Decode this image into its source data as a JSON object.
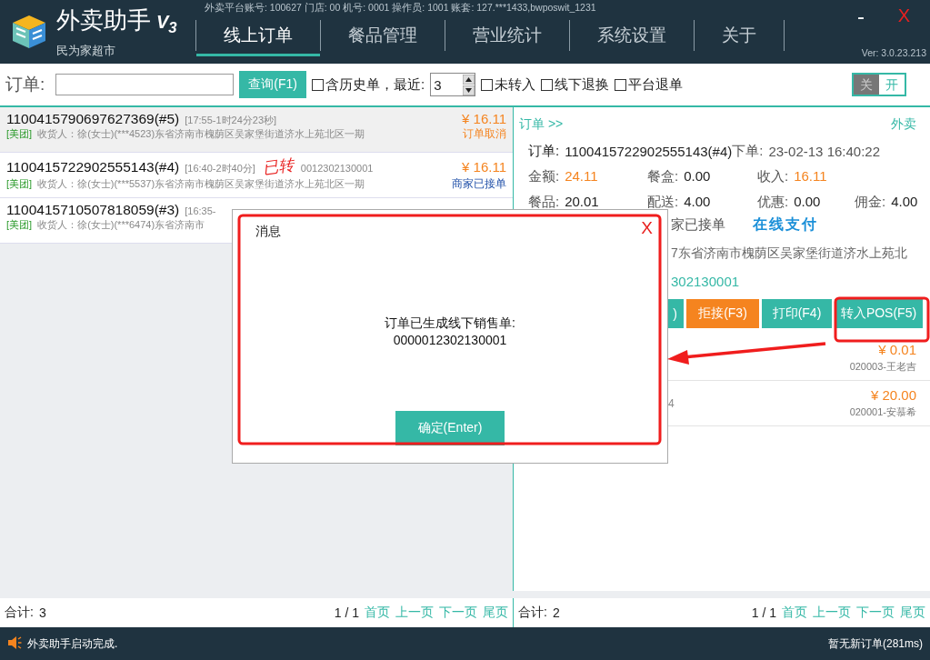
{
  "app": {
    "name": "外卖助手",
    "version_badge": "V$_{3}$",
    "subtitle": "民为家超市",
    "account_info": "外卖平台账号: 100627 门店: 00 机号: 0001 操作员: 1001 账套: 127.***1433,bwposwit_1231",
    "version": "Ver: 3.0.23.213",
    "minimize": "-",
    "close": "X"
  },
  "nav_tabs": [
    {
      "label": "线上订单",
      "selected": true
    },
    {
      "label": "餐品管理",
      "selected": false
    },
    {
      "label": "营业统计",
      "selected": false
    },
    {
      "label": "系统设置",
      "selected": false
    },
    {
      "label": "关于",
      "selected": false
    }
  ],
  "toolbar": {
    "order_label": "订单:",
    "search_button": "查询(F1)",
    "history": {
      "label": "含历史单，最近:",
      "checked": false
    },
    "recent_days": "3",
    "filters": [
      {
        "label": "未转入",
        "checked": false
      },
      {
        "label": "线下退换",
        "checked": false
      },
      {
        "label": "平台退单",
        "checked": false
      }
    ],
    "toggle": {
      "off_label": "关",
      "on_label": "开",
      "on": true
    }
  },
  "orders": [
    {
      "number": "1100415790697627369(#5)",
      "time": "[17:55-1时24分23秒]",
      "platform": "[美团]",
      "address": "收货人：徐(女士)(***4523)东省济南市槐荫区吴家堡街道济水上苑北区一期",
      "amount": "¥ 16.11",
      "status": "订单取消",
      "kind": "cancelled",
      "selected": true
    },
    {
      "number": "1100415722902555143(#4)",
      "time": "[16:40-2时40分]",
      "stamp": "已转",
      "pos_note": "0012302130001",
      "platform": "[美团]",
      "address": "收货人：徐(女士)(***5537)东省济南市槐荫区吴家堡街道济水上苑北区一期",
      "amount": "¥ 16.11",
      "status": "商家已接单",
      "kind": "accepted",
      "selected": false
    },
    {
      "number": "1100415710507818059(#3)",
      "time": "[16:35-",
      "platform": "[美团]",
      "address": "收货人：徐(女士)(***6474)东省济南市",
      "selected": false
    }
  ],
  "detail": {
    "breadcrumb": "订单 >>",
    "channel": "外卖",
    "order_label": "订单:",
    "order_number": "1100415722902555143(#4)",
    "placed_label": "下单:",
    "placed_time": "23-02-13 16:40:22",
    "field_rows": [
      [
        {
          "label": "金额:",
          "value": "24.11",
          "highlight": true
        },
        {
          "label": "餐盒:",
          "value": "0.00",
          "highlight": false
        },
        {
          "label": "收入:",
          "value": "16.11",
          "highlight": true
        }
      ],
      [
        {
          "label": "餐品:",
          "value": "20.01",
          "highlight": false
        },
        {
          "label": "配送:",
          "value": "4.00",
          "highlight": false
        },
        {
          "label": "优惠:",
          "value": "0.00",
          "highlight": false
        },
        {
          "label": "佣金:",
          "value": "4.00",
          "highlight": false
        }
      ]
    ],
    "status": "家已接单",
    "payment": "在线支付",
    "address": "7东省济南市槐荫区吴家堡街道济水上苑北",
    "pos_number": "302130001",
    "actions": [
      {
        "label": ")",
        "kind": "primary"
      },
      {
        "label": "拒接(F3)",
        "kind": "warning"
      },
      {
        "label": "打印(F4)",
        "kind": "primary"
      },
      {
        "label": "转入POS(F5)",
        "kind": "primary"
      }
    ],
    "items": [
      {
        "price": "¥ 0.01",
        "product": "020003-王老吉"
      },
      {
        "code": "4",
        "price": "¥ 20.00",
        "product": "020001-安慕希"
      }
    ]
  },
  "footers": [
    {
      "total_label": "合计:",
      "total": "3",
      "pages": "1 / 1",
      "links": [
        "首页",
        "上一页",
        "下一页",
        "尾页"
      ]
    },
    {
      "total_label": "合计:",
      "total": "2",
      "pages": "1 / 1",
      "links": [
        "首页",
        "上一页",
        "下一页",
        "尾页"
      ]
    }
  ],
  "status_bar": {
    "message": "外卖助手启动完成.",
    "right": "暂无新订单(281ms)"
  },
  "dialog": {
    "title": "消息",
    "close": "X",
    "message": "订单已生成线下销售单:",
    "number": "0000012302130001",
    "button": "确定(Enter)"
  }
}
